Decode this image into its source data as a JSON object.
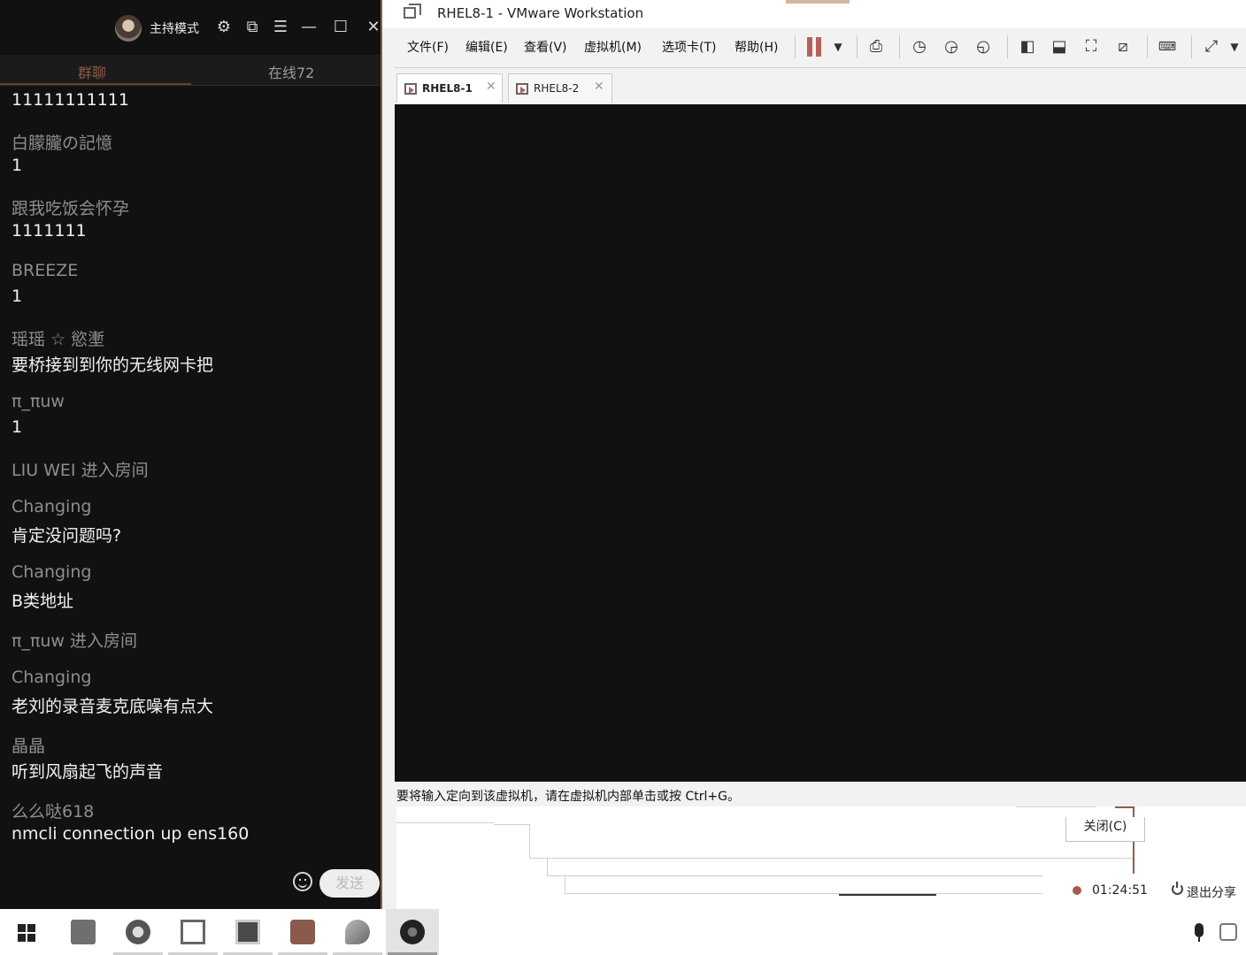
{
  "chat": {
    "header": {
      "mode_label": "主持模式"
    },
    "tabs": {
      "group": "群聊",
      "online": "在线72"
    },
    "messages": [
      {
        "name": "",
        "text": "11111111111"
      },
      {
        "name": "白朦朧の記憶",
        "text": "1"
      },
      {
        "name": "跟我吃饭会怀孕",
        "text": "1111111"
      },
      {
        "name": "BREEZE",
        "text": "1"
      },
      {
        "name": "瑶瑶 ☆ 慾壍",
        "text": "要桥接到到你的无线网卡把"
      },
      {
        "name": "π_πuw",
        "text": "1"
      },
      {
        "name": "LIU WEI 进入房间",
        "text": ""
      },
      {
        "name": "Changing",
        "text": "肯定没问题吗?"
      },
      {
        "name": "Changing",
        "text": "B类地址"
      },
      {
        "name": "π_πuw 进入房间",
        "text": ""
      },
      {
        "name": "Changing",
        "text": "老刘的录音麦克底噪有点大"
      },
      {
        "name": "晶晶",
        "text": "听到风扇起飞的声音"
      },
      {
        "name": "么么哒618",
        "text": "nmcli connection up ens160"
      }
    ],
    "send_label": "发送"
  },
  "vmware": {
    "title": "RHEL8-1 - VMware Workstation",
    "menu": [
      "文件(F)",
      "编辑(E)",
      "查看(V)",
      "虚拟机(M)",
      "选项卡(T)",
      "帮助(H)"
    ],
    "tabs": [
      {
        "label": "RHEL8-1",
        "active": true
      },
      {
        "label": "RHEL8-2",
        "active": false
      }
    ],
    "status_hint": "要将输入定向到该虚拟机，请在虚拟机内部单击或按 Ctrl+G。",
    "close_button": "关闭(C)"
  },
  "recording": {
    "time": "01:24:51",
    "exit_label": "退出分享",
    "dot_color": "#a8574d"
  },
  "colors": {
    "chat_bg": "#111111",
    "accent": "#8d5d51",
    "console_bg": "#111111"
  }
}
